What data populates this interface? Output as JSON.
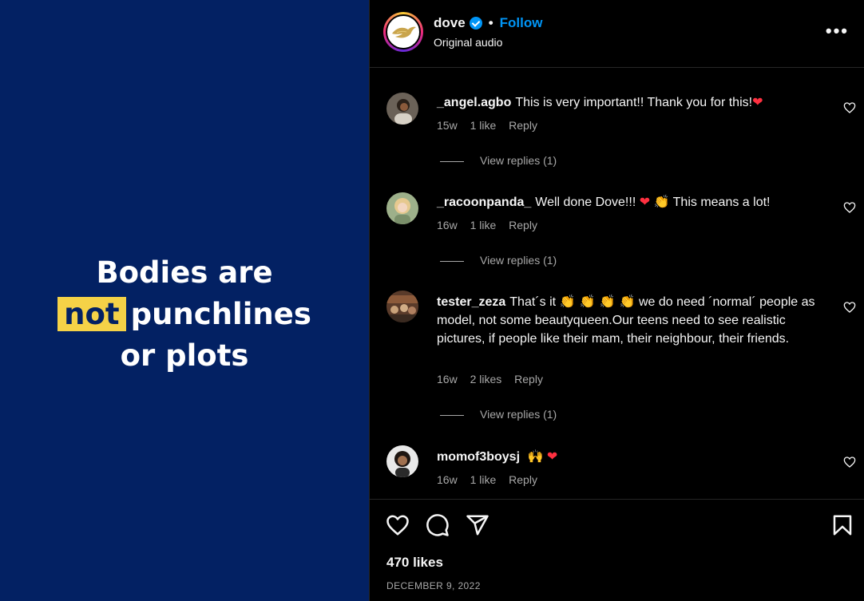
{
  "media": {
    "line1": "Bodies are",
    "highlight": "not",
    "line2_rest": "punchlines",
    "line3": "or plots"
  },
  "header": {
    "username": "dove",
    "separator": "•",
    "follow_label": "Follow",
    "audio_label": "Original audio",
    "more_label": "•••",
    "verified_icon": "verified-badge-icon"
  },
  "comments": [
    {
      "username": "_angel.agbo",
      "text": "This is very important!! Thank you for this!",
      "emojis": "❤",
      "age": "15w",
      "likes": "1 like",
      "reply": "Reply",
      "view_replies": "View replies (1)"
    },
    {
      "username": "_racoonpanda_",
      "text_a": "Well done Dove!!!",
      "emoji_heart": "❤",
      "emoji_clap": "👏",
      "text_b": "This means a lot!",
      "age": "16w",
      "likes": "1 like",
      "reply": "Reply",
      "view_replies": "View replies (1)"
    },
    {
      "username": "tester_zeza",
      "text_a": "That´s it",
      "claps": "👏 👏 👏 👏",
      "text_b": "we do need ´normal´ people as model, not some beautyqueen.Our teens need to see realistic pictures, if people like their mam, their neighbour, their friends.",
      "age": "16w",
      "likes": "2 likes",
      "reply": "Reply",
      "view_replies": "View replies (1)"
    },
    {
      "username": "momof3boysj",
      "emoji_hands": "🙌",
      "emoji_heart": "❤",
      "age": "16w",
      "likes": "1 like",
      "reply": "Reply"
    }
  ],
  "footer": {
    "likes": "470 likes",
    "date": "DECEMBER 9, 2022"
  },
  "colors": {
    "media_bg": "#032163",
    "highlight": "#f5d247",
    "follow": "#0095f6",
    "heart": "#ff3040"
  }
}
